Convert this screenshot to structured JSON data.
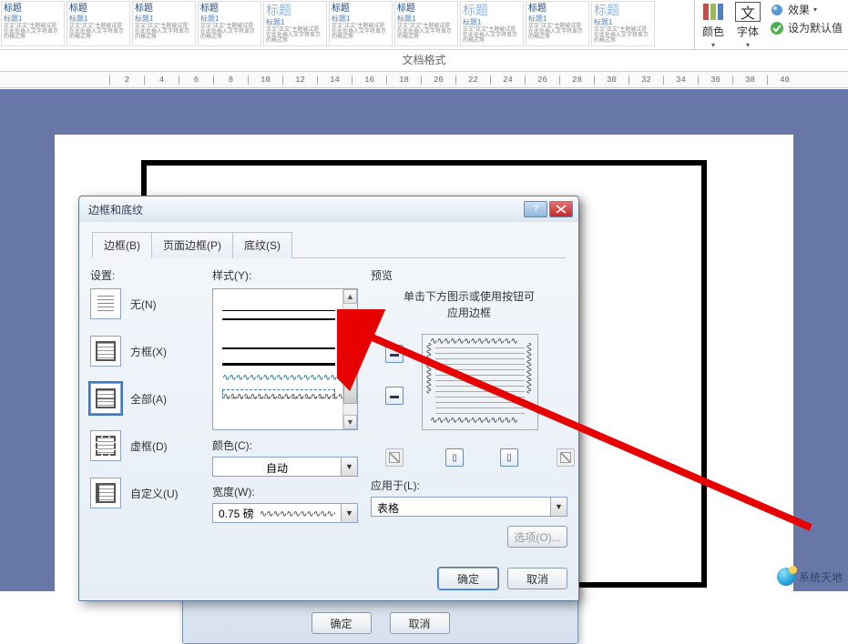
{
  "ribbon": {
    "styles": [
      {
        "title": "标题"
      },
      {
        "title": "标题"
      },
      {
        "title": "标题"
      },
      {
        "title": "标题"
      },
      {
        "title": "标题",
        "accent": true
      },
      {
        "title": "标题"
      },
      {
        "title": "标题"
      },
      {
        "title": "标题",
        "accent": true
      },
      {
        "title": "标题"
      },
      {
        "title": "标题",
        "accent": true
      }
    ],
    "group_label": "文档格式",
    "color_label": "颜色",
    "font_label": "字体",
    "effects_label": "效果",
    "set_default_label": "设为默认值"
  },
  "ruler_marks": [
    "2",
    "4",
    "6",
    "8",
    "10",
    "12",
    "14",
    "16",
    "18",
    "20",
    "22",
    "24",
    "26",
    "28",
    "30",
    "32",
    "34",
    "36",
    "38",
    "40"
  ],
  "inner_dialog": {
    "ok": "确定",
    "cancel": "取消"
  },
  "dialog": {
    "title": "边框和底纹",
    "tabs": {
      "border": "边框(B)",
      "page_border": "页面边框(P)",
      "shading": "底纹(S)"
    },
    "settings_label": "设置:",
    "settings": {
      "none": "无(N)",
      "box": "方框(X)",
      "all": "全部(A)",
      "grid": "虚框(D)",
      "custom": "自定义(U)"
    },
    "style_label": "样式(Y):",
    "color_label": "颜色(C):",
    "color_value": "自动",
    "width_label": "宽度(W):",
    "width_value": "0.75 磅",
    "preview_label": "预览",
    "preview_hint_1": "单击下方图示或使用按钮可",
    "preview_hint_2": "应用边框",
    "apply_label": "应用于(L):",
    "apply_value": "表格",
    "options_btn": "选项(O)...",
    "ok": "确定",
    "cancel": "取消"
  },
  "watermark_text": "系统天地"
}
